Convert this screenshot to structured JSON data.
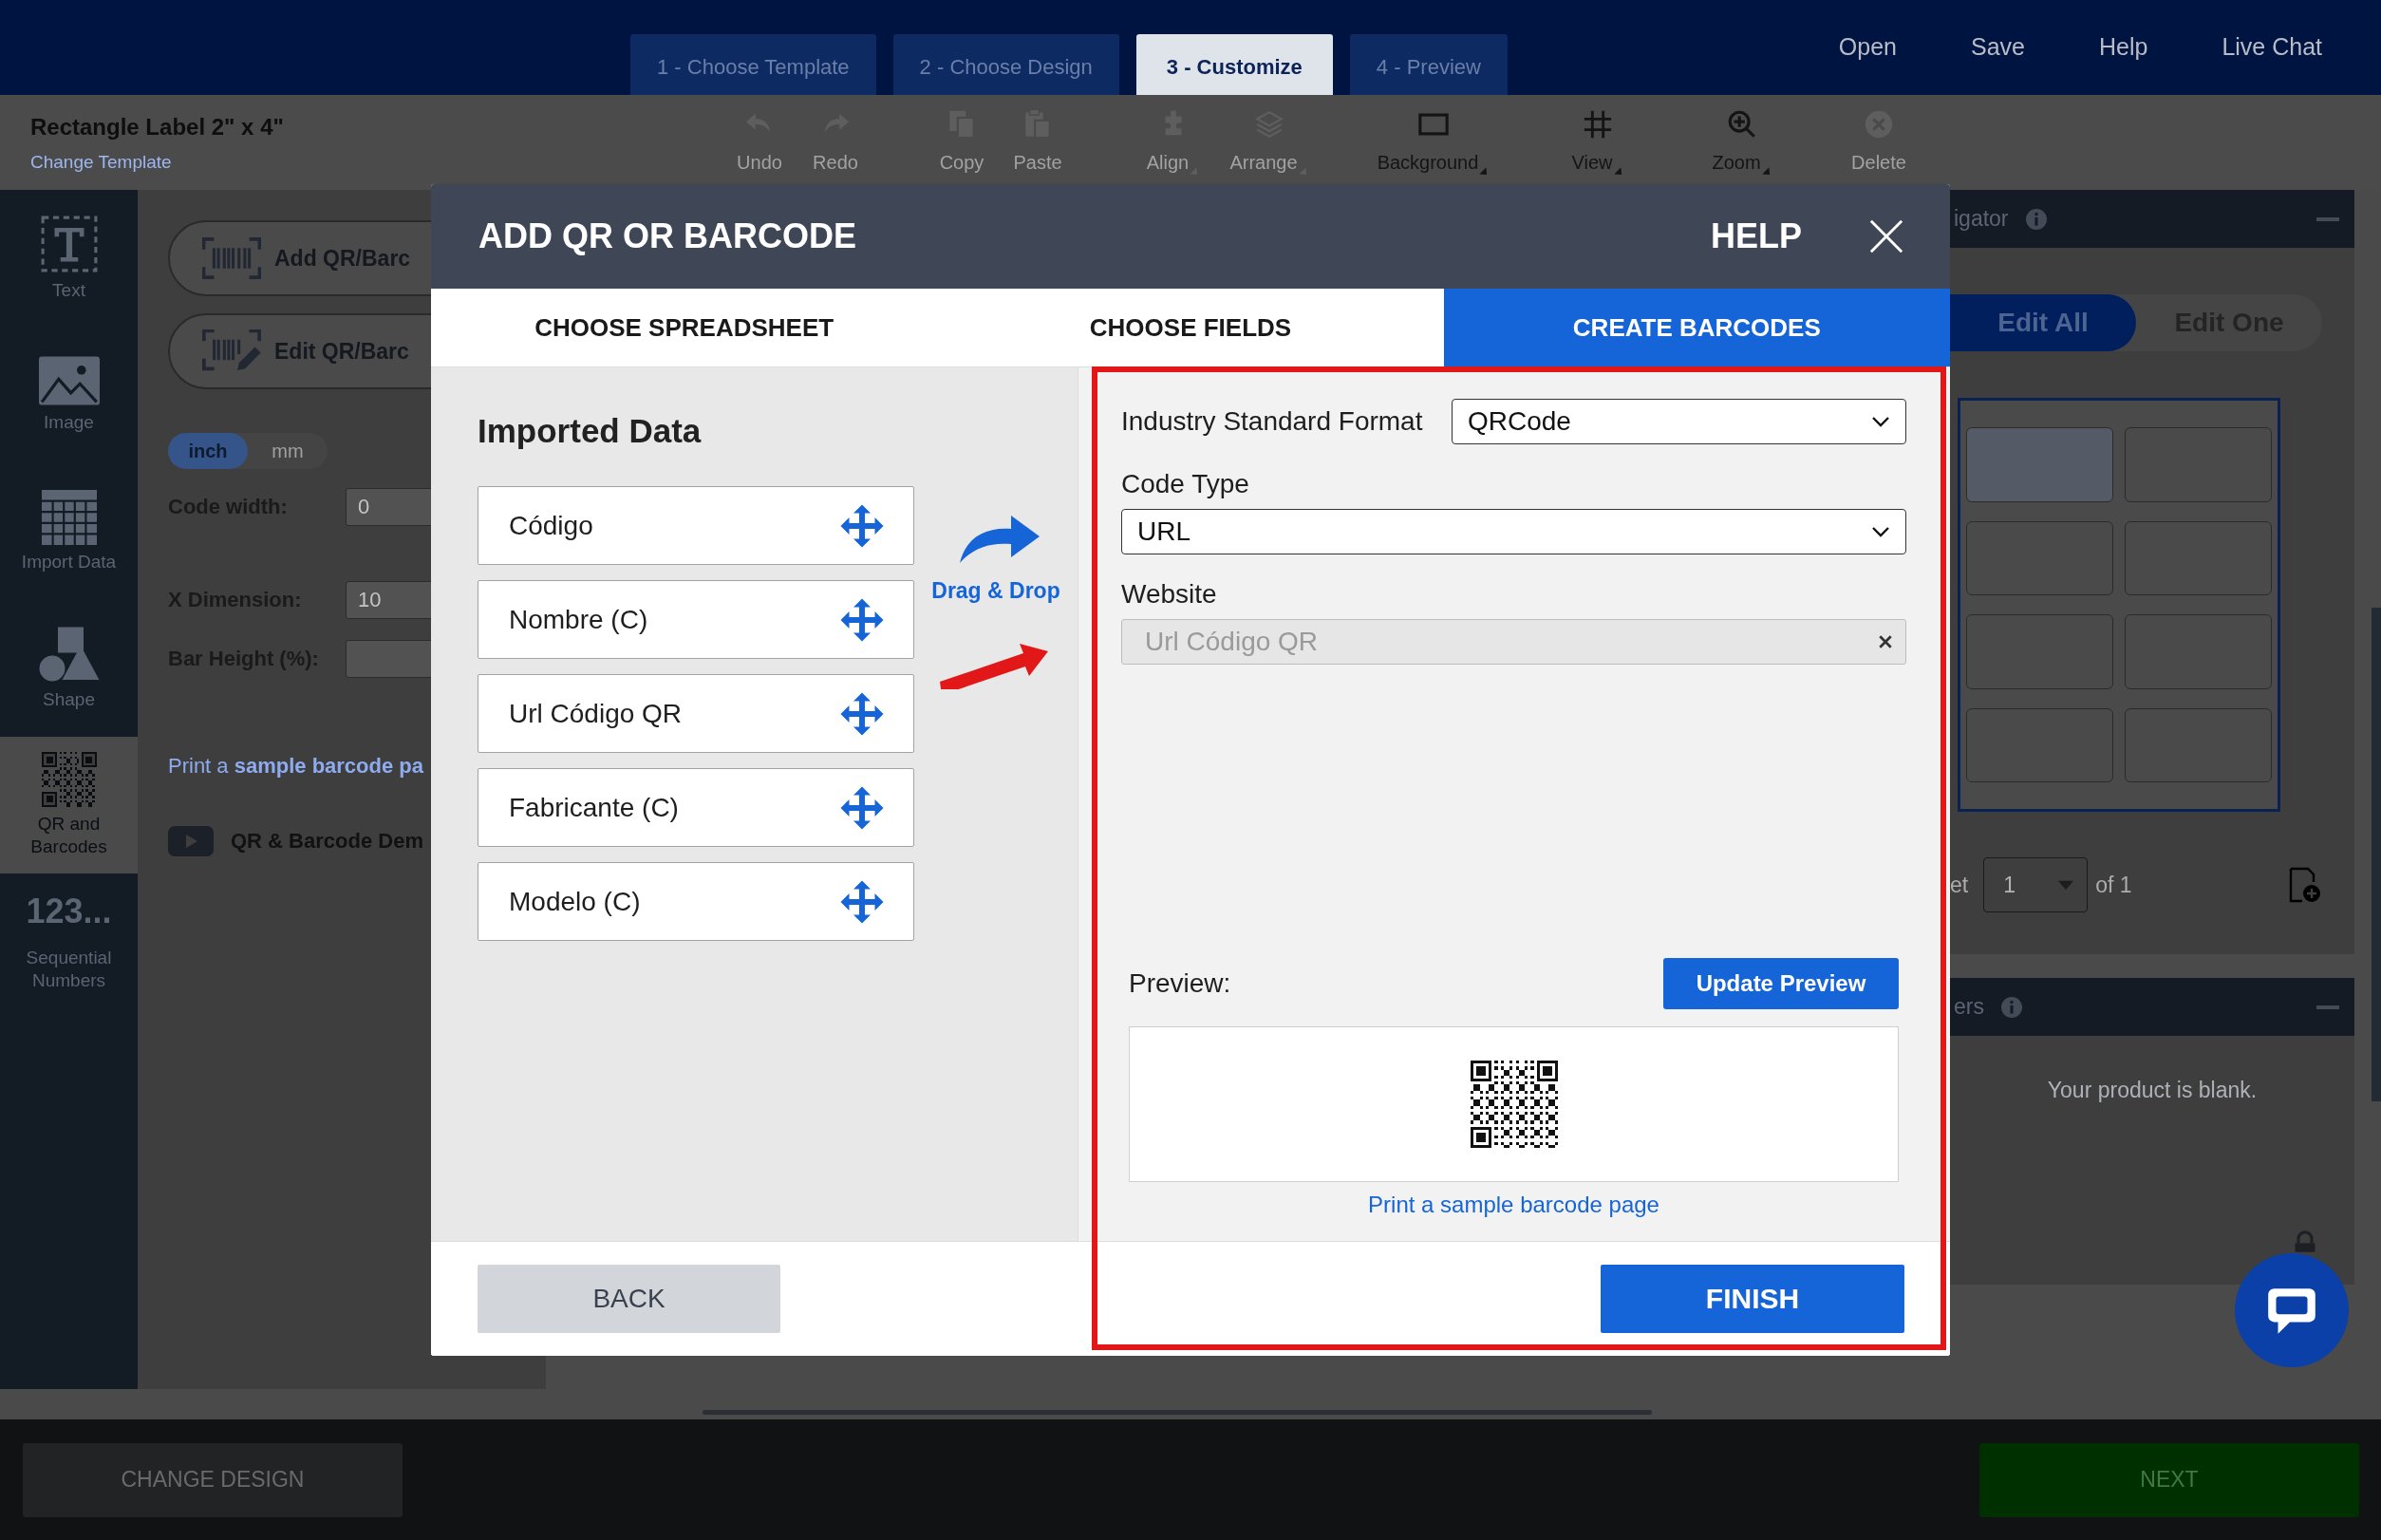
{
  "top_bar": {
    "steps": [
      {
        "label": "1 - Choose Template",
        "selected": false
      },
      {
        "label": "2 - Choose Design",
        "selected": false
      },
      {
        "label": "3 - Customize",
        "selected": true
      },
      {
        "label": "4 - Preview",
        "selected": false
      }
    ],
    "links": [
      "Open",
      "Save",
      "Help",
      "Live Chat"
    ]
  },
  "toolbar": {
    "title": "Rectangle Label 2\" x 4\"",
    "change_link": "Change Template",
    "tools": [
      {
        "label": "Undo",
        "disabled": true,
        "menu": false
      },
      {
        "label": "Redo",
        "disabled": true,
        "menu": false
      },
      {
        "label": "Copy",
        "disabled": true,
        "menu": false
      },
      {
        "label": "Paste",
        "disabled": true,
        "menu": false
      },
      {
        "label": "Align",
        "disabled": true,
        "menu": true
      },
      {
        "label": "Arrange",
        "disabled": true,
        "menu": true
      },
      {
        "label": "Background",
        "disabled": false,
        "menu": true
      },
      {
        "label": "View",
        "disabled": false,
        "menu": true
      },
      {
        "label": "Zoom",
        "disabled": false,
        "menu": true
      },
      {
        "label": "Delete",
        "disabled": true,
        "menu": false
      }
    ]
  },
  "sidebar": {
    "items": [
      {
        "label": "Text",
        "selected": false
      },
      {
        "label": "Image",
        "selected": false
      },
      {
        "label": "Import Data",
        "selected": false
      },
      {
        "label": "Shape",
        "selected": false
      },
      {
        "label": "QR and Barcodes",
        "selected": true
      },
      {
        "label": "Sequential Numbers",
        "glyph": "123...",
        "selected": false
      }
    ]
  },
  "panel": {
    "buttons": [
      {
        "label": "Add QR/Barc"
      },
      {
        "label": "Edit QR/Barc"
      }
    ],
    "units": [
      {
        "label": "inch",
        "selected": true
      },
      {
        "label": "mm",
        "selected": false
      }
    ],
    "fields": [
      {
        "label": "Code width:",
        "value": "0"
      },
      {
        "label": "X Dimension:",
        "value": "10"
      },
      {
        "label": "Bar Height (%):"
      }
    ],
    "sample_link": "Print a **sample barcode pa**",
    "demo_link": "QR & Barcode Dem"
  },
  "navigator": {
    "title": "igator",
    "modes": [
      {
        "label": "Edit All",
        "selected": true
      },
      {
        "label": "Edit One",
        "selected": false
      }
    ],
    "cells": [
      {
        "selected": true
      },
      {
        "selected": false
      },
      {
        "selected": false
      },
      {
        "selected": false
      },
      {
        "selected": false
      },
      {
        "selected": false
      },
      {
        "selected": false
      },
      {
        "selected": false
      }
    ],
    "sheet_prefix": "et",
    "sheet_value": "1",
    "sheet_suffix": "of 1"
  },
  "layers": {
    "title": "ers",
    "empty_message": "Your product is blank."
  },
  "bottom_bar": {
    "back": "CHANGE DESIGN",
    "next": "NEXT"
  },
  "dialog": {
    "title": "ADD QR OR BARCODE",
    "help": "HELP",
    "tabs": [
      {
        "label": "CHOOSE SPREADSHEET",
        "selected": false
      },
      {
        "label": "CHOOSE FIELDS",
        "selected": false
      },
      {
        "label": "CREATE BARCODES",
        "selected": true
      }
    ],
    "imported_heading": "Imported Data",
    "data_fields": [
      "Código",
      "Nombre (C)",
      "Url Código QR",
      "Fabricante (C)",
      "Modelo (C)"
    ],
    "drag_hint": "Drag & Drop",
    "format": {
      "label": "Industry Standard Format",
      "value": "QRCode"
    },
    "code_type": {
      "label": "Code Type",
      "value": "URL"
    },
    "website": {
      "label": "Website",
      "placeholder": "Url Código QR"
    },
    "preview_label": "Preview:",
    "update_button": "Update Preview",
    "sample_link": "Print a sample barcode page",
    "back_button": "BACK",
    "finish_button": "FINISH",
    "highlight_frame": true
  }
}
